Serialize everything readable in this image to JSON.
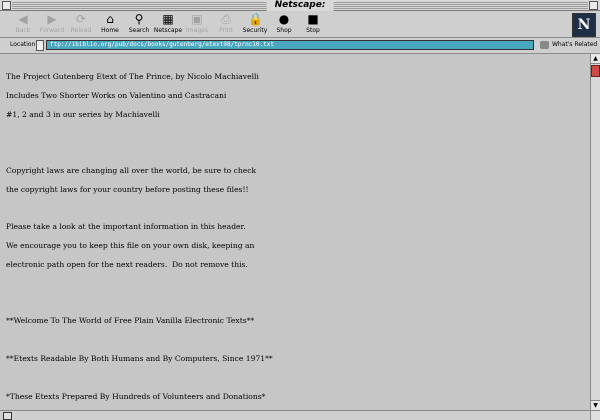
{
  "window": {
    "title": "Netscape:"
  },
  "toolbar": {
    "buttons": [
      {
        "label": "Back",
        "icon": "back-arrow-icon",
        "glyph": "◀",
        "enabled": false
      },
      {
        "label": "Forward",
        "icon": "forward-arrow-icon",
        "glyph": "▶",
        "enabled": false
      },
      {
        "label": "Reload",
        "icon": "reload-icon",
        "glyph": "⟳",
        "enabled": false
      },
      {
        "label": "Home",
        "icon": "home-icon",
        "glyph": "⌂",
        "enabled": true
      },
      {
        "label": "Search",
        "icon": "search-icon",
        "glyph": "⚲",
        "enabled": true
      },
      {
        "label": "Netscape",
        "icon": "netscape-icon",
        "glyph": "▦",
        "enabled": true
      },
      {
        "label": "Images",
        "icon": "images-icon",
        "glyph": "▣",
        "enabled": false
      },
      {
        "label": "Print",
        "icon": "print-icon",
        "glyph": "⎙",
        "enabled": false
      },
      {
        "label": "Security",
        "icon": "security-lock-icon",
        "glyph": "🔒",
        "enabled": true
      },
      {
        "label": "Shop",
        "icon": "shop-icon",
        "glyph": "●",
        "enabled": true
      },
      {
        "label": "Stop",
        "icon": "stop-icon",
        "glyph": "■",
        "enabled": true
      }
    ],
    "logo": "N"
  },
  "location": {
    "label": "Location:",
    "url": "ftp://ibiblio.org/pub/docs/books/gutenberg/etext98/tprnc10.txt",
    "related_label": "What's Related"
  },
  "document": {
    "lines": [
      "The Project Gutenberg Etext of The Prince, by Nicolo Machiavelli",
      "Includes Two Shorter Works on Valentino and Castracani",
      "#1, 2 and 3 in our series by Machiavelli",
      "",
      "",
      "Copyright laws are changing all over the world, be sure to check",
      "the copyright laws for your country before posting these files!!",
      "",
      "Please take a look at the important information in this header.",
      "We encourage you to keep this file on your own disk, keeping an",
      "electronic path open for the next readers.  Do not remove this.",
      "",
      "",
      "**Welcome To The World of Free Plain Vanilla Electronic Texts**",
      "",
      "**Etexts Readable By Both Humans and By Computers, Since 1971**",
      "",
      "*These Etexts Prepared By Hundreds of Volunteers and Donations*"
    ]
  },
  "colors": {
    "url_background": "#4aa7c0",
    "scroll_thumb": "#d04848",
    "window_background": "#c6c6c6"
  }
}
